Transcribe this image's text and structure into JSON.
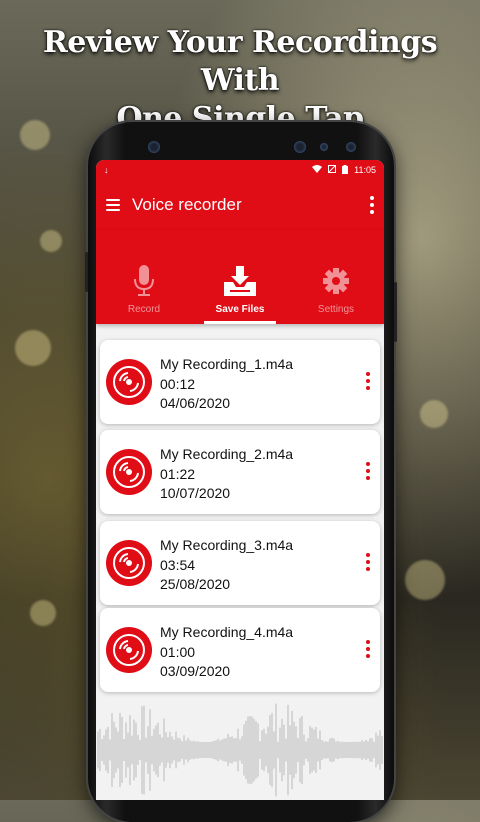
{
  "headline": {
    "line1": "Review Your Recordings With",
    "line2": "One Single Tap"
  },
  "statusbar": {
    "time": "11:05"
  },
  "appbar": {
    "title": "Voice recorder"
  },
  "tabs": [
    {
      "label": "Record",
      "icon": "microphone-icon",
      "active": false
    },
    {
      "label": "Save Files",
      "icon": "download-tray-icon",
      "active": true
    },
    {
      "label": "Settings",
      "icon": "gear-icon",
      "active": false
    }
  ],
  "recordings": [
    {
      "name": "My Recording_1.m4a",
      "duration": "00:12",
      "date": "04/06/2020"
    },
    {
      "name": "My Recording_2.m4a",
      "duration": "01:22",
      "date": "10/07/2020"
    },
    {
      "name": "My Recording_3.m4a",
      "duration": "03:54",
      "date": "25/08/2020"
    },
    {
      "name": "My Recording_4.m4a",
      "duration": "01:00",
      "date": "03/09/2020"
    }
  ],
  "colors": {
    "accent": "#e00c16",
    "background": "#f2f2f2",
    "card": "#ffffff"
  }
}
